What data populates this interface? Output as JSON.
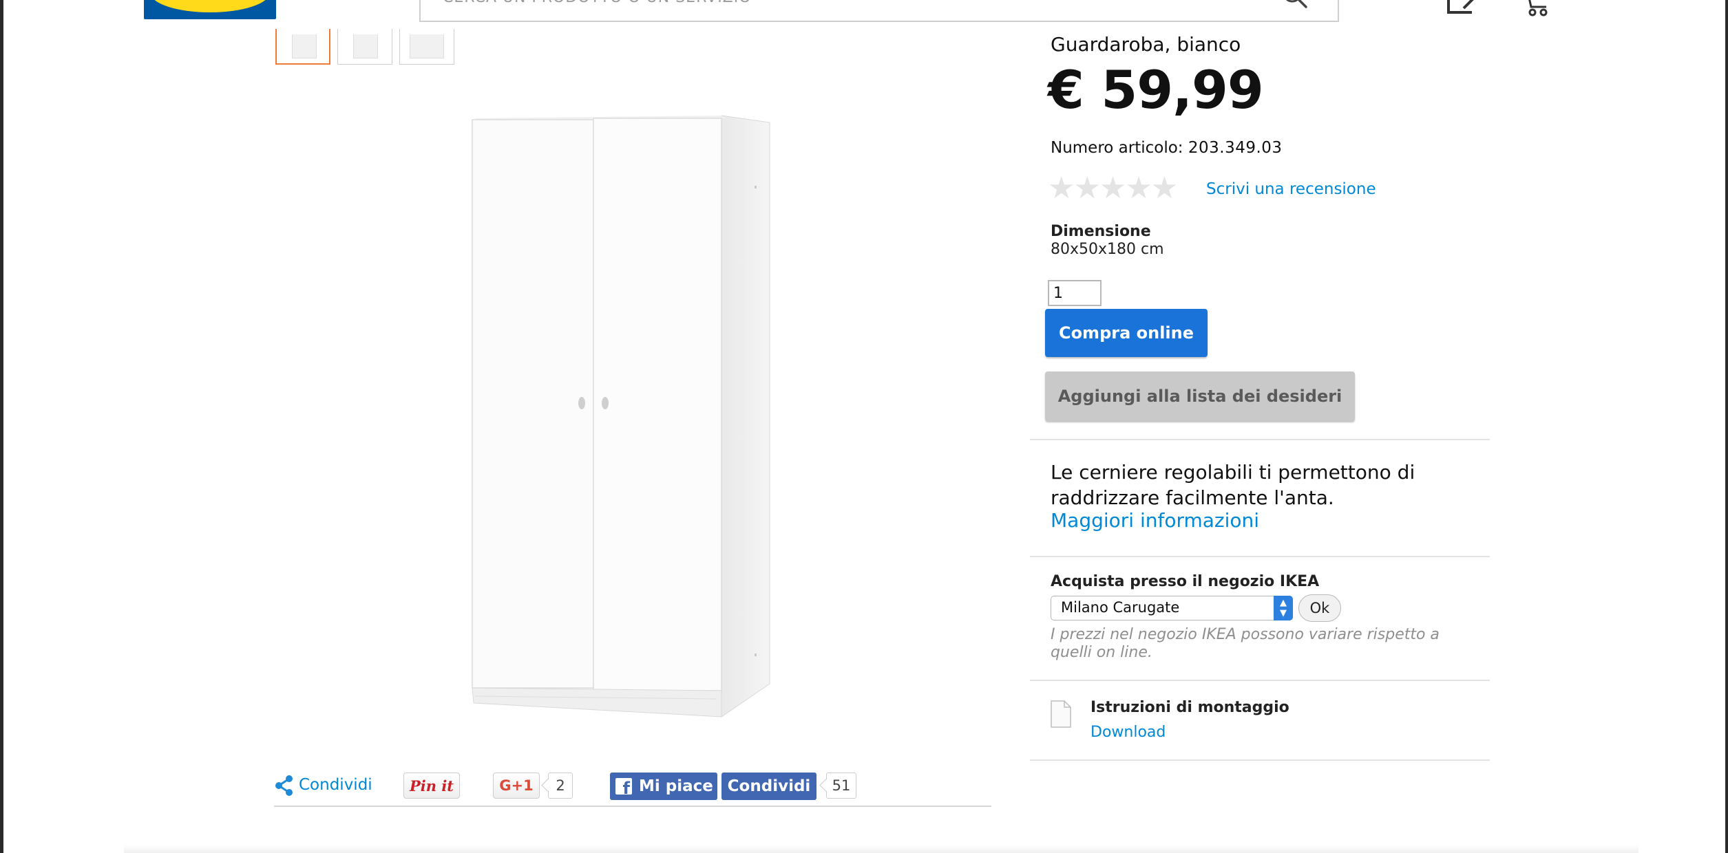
{
  "header": {
    "logo_text": "IKEA",
    "search_placeholder": "CERCA UN PRODOTTO O UN SERVIZIO"
  },
  "gallery": {
    "thumbnail_count": 3,
    "active_index": 0
  },
  "product": {
    "subtitle": "Guardaroba, bianco",
    "price": "€ 59,99",
    "article_label": "Numero articolo:",
    "article_number": "203.349.03",
    "rating_stars": "★★★★★",
    "rating_value": 0,
    "review_link": "Scrivi una recensione",
    "dimension_label": "Dimensione",
    "dimension_value": "80x50x180 cm",
    "quantity": "1",
    "buy_button": "Compra online",
    "wishlist_button": "Aggiungi alla lista dei desideri",
    "description": "Le cerniere regolabili ti permettono di raddrizzare facilmente l'anta.",
    "more_info_link": "Maggiori informazioni"
  },
  "store": {
    "title": "Acquista presso il negozio IKEA",
    "selected_store": "Milano Carugate",
    "ok_button": "Ok",
    "note": "I prezzi nel negozio IKEA possono variare rispetto a quelli on line."
  },
  "assembly": {
    "title": "Istruzioni di montaggio",
    "download_link": "Download"
  },
  "share": {
    "share_label": "Condividi",
    "pinterest_label": "Pin it",
    "gplus_label": "G+1",
    "gplus_count": "2",
    "fb_like_label": "Mi piace",
    "fb_share_label": "Condividi",
    "fb_count": "51"
  },
  "colors": {
    "accent_blue": "#1a73d9",
    "link_blue": "#0088d6",
    "active_thumb_orange": "#ef7b35",
    "facebook_blue": "#4267b2",
    "ikea_blue": "#0058a3",
    "ikea_yellow": "#ffda1a"
  }
}
